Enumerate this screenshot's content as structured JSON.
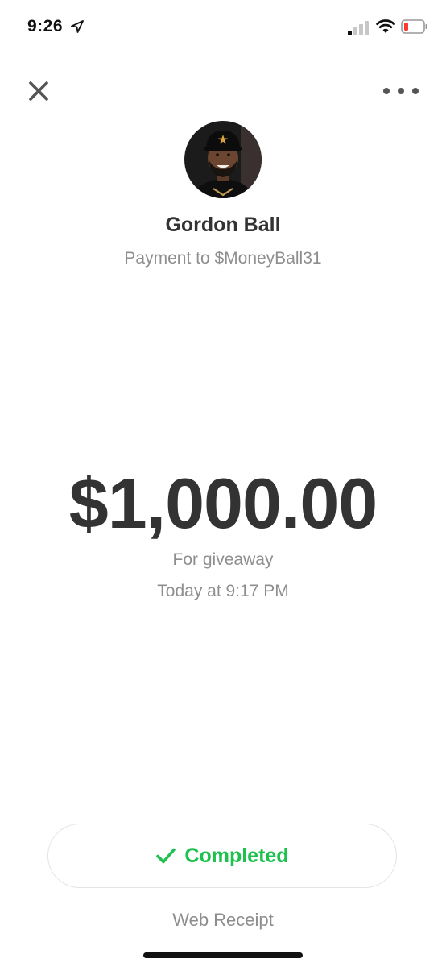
{
  "status_bar": {
    "time": "9:26",
    "icons": [
      "location-arrow-icon",
      "cellular-signal-icon",
      "wifi-icon",
      "battery-low-icon"
    ]
  },
  "header": {
    "close_icon": "close-icon",
    "more_icon": "more-options-icon"
  },
  "recipient": {
    "name": "Gordon Ball",
    "subtitle": "Payment to $MoneyBall31"
  },
  "payment": {
    "amount": "$1,000.00",
    "note": "For giveaway",
    "date": "Today at 9:17 PM"
  },
  "status": {
    "label": "Completed",
    "icon": "checkmark-icon",
    "color": "#1ec14e"
  },
  "footer": {
    "receipt_link": "Web Receipt"
  }
}
